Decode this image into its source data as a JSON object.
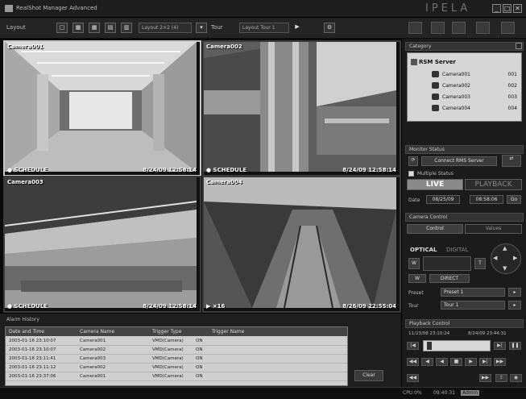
{
  "window": {
    "title": "RealShot Manager Advanced",
    "brand": "IPELA",
    "buttons": [
      "_",
      "□",
      "✕"
    ]
  },
  "toolbar": {
    "layout_label": "Layout",
    "layout_select": "Layout 2×2 (4)",
    "tour_label": "Tour",
    "tour_select": "Layout Tour 1",
    "play_glyph": "▶"
  },
  "cameras": [
    {
      "name": "Camera001",
      "mode": "● SCHEDULE",
      "time": "8/24/09 12:58:14"
    },
    {
      "name": "Camera002",
      "mode": "● SCHEDULE",
      "time": "8/24/09 12:58:14"
    },
    {
      "name": "Camera003",
      "mode": "● SCHEDULE",
      "time": "8/24/09 12:58:14"
    },
    {
      "name": "Camera004",
      "mode": "▶ ×16",
      "time": "8/26/09 22:55:04"
    }
  ],
  "category": {
    "header": "Category",
    "root": "RSM Server",
    "items": [
      {
        "name": "Camera001",
        "id": "001"
      },
      {
        "name": "Camera002",
        "id": "002"
      },
      {
        "name": "Camera003",
        "id": "003"
      },
      {
        "name": "Camera004",
        "id": "004"
      }
    ]
  },
  "monitor_status": {
    "header": "Monitor Status",
    "connect_label": "Connect RMS Server",
    "checkbox_label": "Multiple Status",
    "live": "LIVE",
    "playback": "PLAYBACK",
    "date_label": "Date",
    "date_value": "08/25/09",
    "time_value": "08:58:06",
    "go": "Go"
  },
  "camera_control": {
    "header": "Camera Control",
    "tab_control": "Control",
    "tab_values": "Values",
    "optical": "OPTICAL",
    "digital": "DIGITAL",
    "arrows": [
      "◀",
      "▶",
      "▲",
      "▼"
    ],
    "w": "W",
    "t": "T",
    "direct": "DIRECT",
    "preset_label": "Preset",
    "preset_value": "Preset 1",
    "tour_label": "Tour",
    "tour_value": "Tour 1"
  },
  "playback_control": {
    "header": "Playback Control",
    "start": "11/23/08 23:10:24",
    "end": "8/24/09 23:44:31",
    "buttons": [
      "◀◀",
      "|◀",
      "◀",
      "■",
      "▶",
      "▶|",
      "▶▶"
    ]
  },
  "event_viewer": {
    "header": "Alarm History",
    "columns": [
      "Date and Time",
      "Camera Name",
      "Trigger Type",
      "Trigger Name"
    ],
    "rows": [
      [
        "2003-01-16 23:10:07",
        "Camera001",
        "VMD(Camera)",
        "ON"
      ],
      [
        "2003-01-16 23:10:07",
        "Camera002",
        "VMD(Camera)",
        "ON"
      ],
      [
        "2003-01-16 23:11:41",
        "Camera003",
        "VMD(Camera)",
        "ON"
      ],
      [
        "2003-01-16 23:11:12",
        "Camera002",
        "VMD(Camera)",
        "ON"
      ],
      [
        "2003-01-16 23:37:06",
        "Camera001",
        "VMD(Camera)",
        "ON"
      ]
    ],
    "clear": "Clear"
  },
  "status": {
    "cpu": "CPU:0%",
    "clock": "09:40:31",
    "admin": "Admin"
  }
}
